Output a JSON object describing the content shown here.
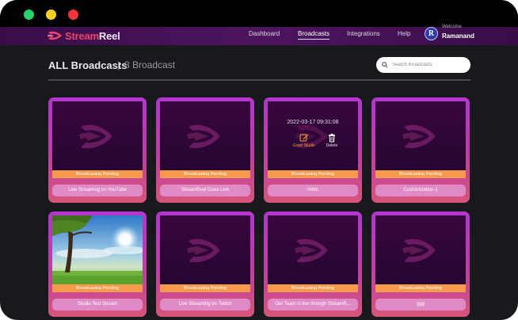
{
  "window": {
    "controls": [
      "green",
      "yellow",
      "red"
    ]
  },
  "header": {
    "brand_part1": "Stream",
    "brand_part2": "Reel",
    "nav": {
      "dashboard": "Dashboard",
      "broadcasts": "Broadcasts",
      "integrations": "Integrations",
      "help": "Help"
    },
    "user": {
      "greeting": "Welcome",
      "name": "Ramanand",
      "avatar_letter": "R"
    }
  },
  "page": {
    "title": "ALL Broadcasts",
    "separator": "|",
    "count": "8 Broadcast",
    "search_placeholder": "Search Broadcasts"
  },
  "cards": [
    {
      "status": "Broadcasting Pending",
      "name": "Live Streaming on YouTube"
    },
    {
      "status": "Broadcasting Pending",
      "name": "StreamReel Goes Live"
    },
    {
      "status": "Broadcasting Pending",
      "name": "hhhh",
      "hover": {
        "date": "2022-03-17 09:31:08",
        "enter": "Enter Studio",
        "delete": "Delete"
      }
    },
    {
      "status": "Broadcasting Pending",
      "name": "Customization-1"
    },
    {
      "status": "Broadcasting Pending",
      "name": "Studio Test Stream"
    },
    {
      "status": "Broadcasting Pending",
      "name": "Live Streaming on Twitch"
    },
    {
      "status": "Broadcasting Pending",
      "name": "Our Team is live through StreamR..."
    },
    {
      "status": "Broadcasting Pending",
      "name": "ggg"
    }
  ],
  "colors": {
    "background": "#18191d",
    "appbar": "#4d1560",
    "card_border": "#b236d0",
    "status_strip": "#f59a4c",
    "name_pill": "#e18bc6",
    "brand_accent": "#e8466d"
  },
  "icons": [
    "streamreel-logo-icon",
    "search-icon",
    "edit-icon",
    "trash-icon",
    "play-logo-icon"
  ]
}
